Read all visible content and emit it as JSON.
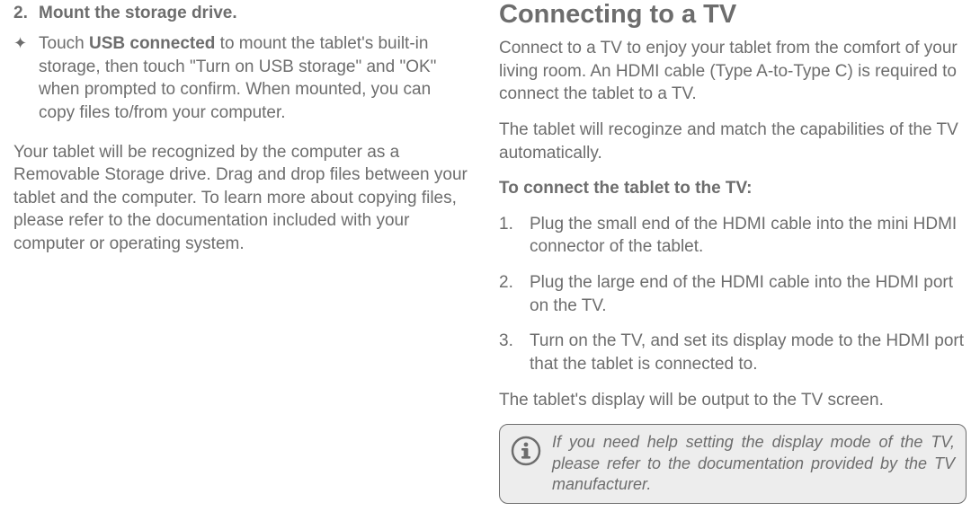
{
  "left": {
    "step2_number": "2.",
    "step2_title": "Mount the storage drive.",
    "sub_bullet_glyph": "✦",
    "sub_touch": "Touch ",
    "sub_usb": "USB connected",
    "sub_rest": " to mount the tablet's  built-in storage, then touch \"Turn on USB storage\" and \"OK\" when prompted to confirm. When mounted, you can copy files to/from your computer.",
    "para": "Your tablet will be recognized by the computer as a Removable Storage drive. Drag and drop files between your tablet and the computer. To learn more about copying files, please refer to the documentation included with your computer or operating system."
  },
  "right": {
    "title": "Connecting to a TV",
    "p1": "Connect to a TV to enjoy your tablet from the comfort of your living room. An HDMI cable (Type A-to-Type C) is required to connect the tablet to a TV.",
    "p2": "The tablet will recoginze and match the capabilities of the TV automatically.",
    "p3": "To connect the tablet to the TV:",
    "steps": [
      {
        "n": "1.",
        "t": "Plug the small end of the HDMI cable into the mini HDMI connector of the tablet."
      },
      {
        "n": "2.",
        "t": "Plug the large end of the HDMI cable into the HDMI port on the TV."
      },
      {
        "n": "3.",
        "t": "Turn on the TV, and set its display mode to the HDMI port that the tablet is connected to."
      }
    ],
    "p4": "The tablet's display will be output to the TV screen.",
    "note": "If you need help setting the display mode of the TV, please refer to the documentation provided by the TV manufacturer."
  }
}
